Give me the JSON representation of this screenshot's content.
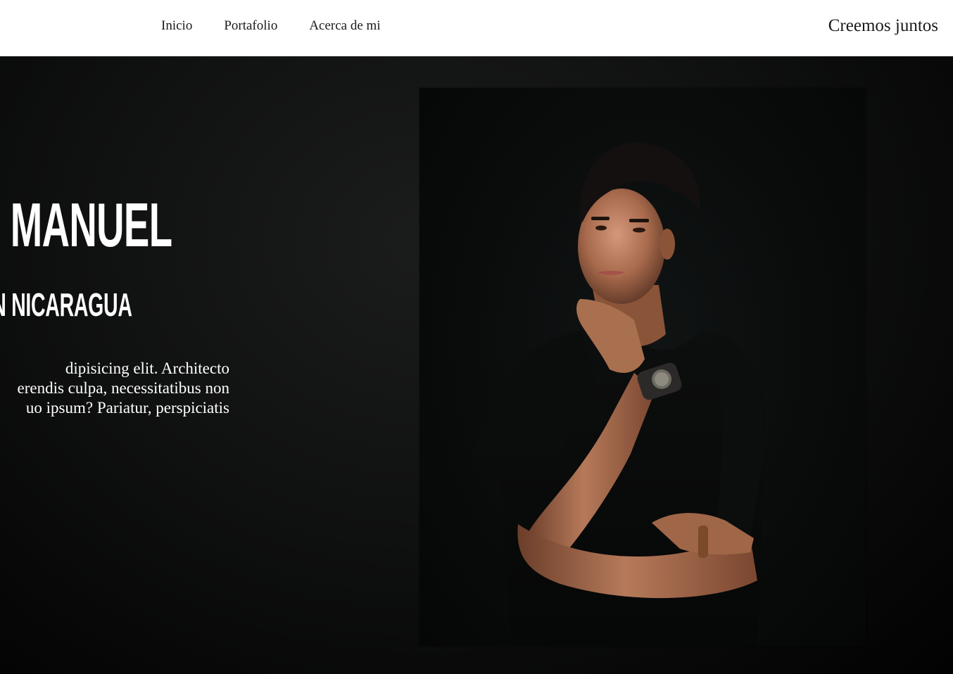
{
  "nav": {
    "links": [
      {
        "label": "Inicio"
      },
      {
        "label": "Portafolio"
      },
      {
        "label": "Acerca de mi"
      }
    ],
    "cta_label": "Creemos juntos"
  },
  "hero": {
    "name_visible": "N MANUEL",
    "subtitle_visible": "N NICARAGUA",
    "text_lines": [
      "dipisicing elit. Architecto",
      "erendis culpa, necessitatibus non",
      "uo ipsum? Pariatur, perspiciatis"
    ]
  },
  "colors": {
    "nav_background": "#ffffff",
    "nav_text": "#1a1a1a",
    "hero_background": "#0e0f0f",
    "hero_text": "#ffffff"
  }
}
